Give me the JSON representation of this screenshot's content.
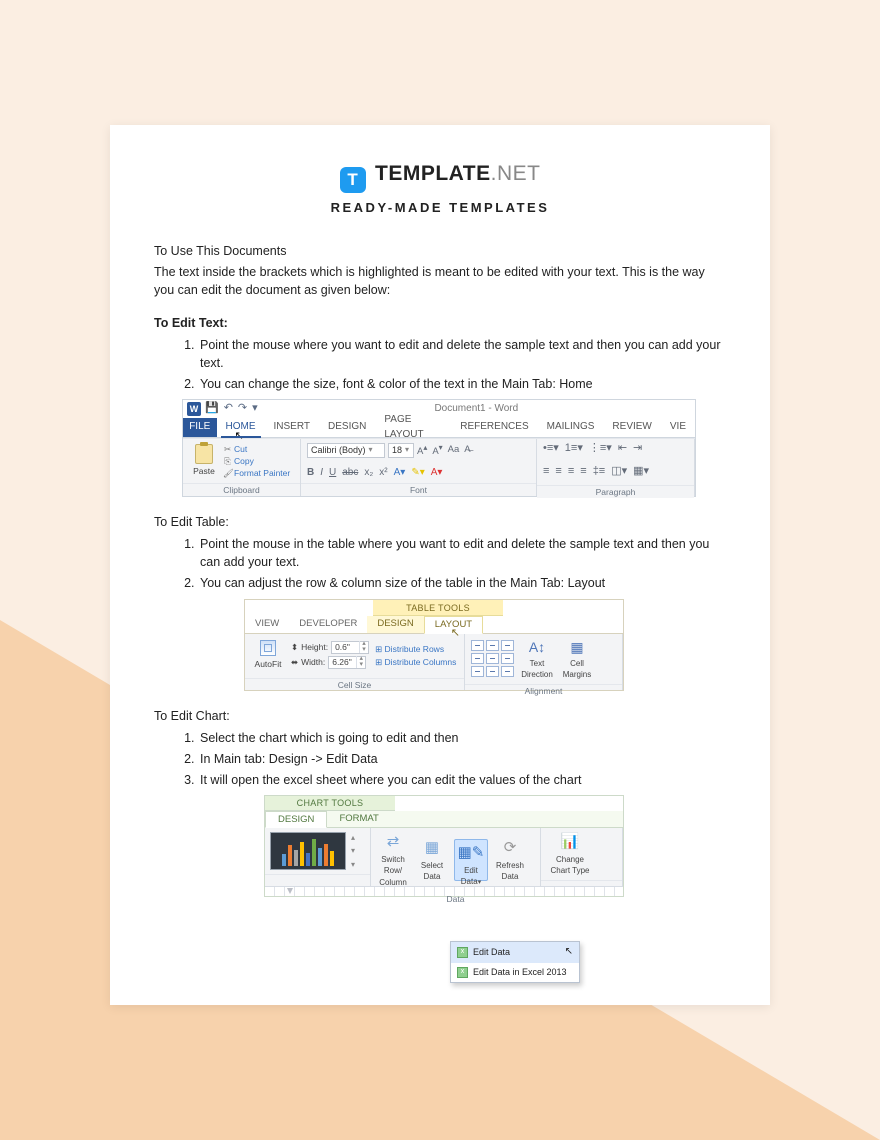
{
  "brand": {
    "badge": "T",
    "name": "TEMPLATE",
    "suffix": ".NET"
  },
  "subtitle": "READY-MADE TEMPLATES",
  "intro": {
    "heading": "To Use This Documents",
    "body": "The text inside the brackets which is highlighted is meant to be edited with your text. This is the way you can edit the document as given below:"
  },
  "sections": {
    "text": {
      "heading": "To Edit Text:",
      "steps": [
        "Point the mouse where you want to edit and delete the sample text and then you can add your text.",
        "You can change the size, font & color of the text in the Main Tab: Home"
      ]
    },
    "table": {
      "heading": "To Edit Table:",
      "steps": [
        "Point the mouse in the table where you want to edit and delete the sample text and then you can add your text.",
        "You can adjust the row & column size of the table in the Main Tab: Layout"
      ]
    },
    "chart": {
      "heading": "To Edit Chart:",
      "steps": [
        "Select the chart which is going to edit and then",
        "In Main tab: Design -> Edit Data",
        "It will open the excel sheet where you can edit the values of the chart"
      ]
    }
  },
  "word_ribbon": {
    "doc_title": "Document1 - Word",
    "file": "FILE",
    "tabs": [
      "HOME",
      "INSERT",
      "DESIGN",
      "PAGE LAYOUT",
      "REFERENCES",
      "MAILINGS",
      "REVIEW",
      "VIE"
    ],
    "clipboard": {
      "paste": "Paste",
      "cut": "Cut",
      "copy": "Copy",
      "format_painter": "Format Painter",
      "group": "Clipboard"
    },
    "font": {
      "family": "Calibri (Body)",
      "size": "18",
      "aa": "Aa",
      "group": "Font",
      "b": "B",
      "i": "I",
      "u": "U",
      "abc": "abc"
    },
    "paragraph": {
      "group": "Paragraph"
    }
  },
  "table_ribbon": {
    "tools_title": "TABLE TOOLS",
    "tabs_left": [
      "VIEW",
      "DEVELOPER"
    ],
    "tabs_tool": [
      "DESIGN",
      "LAYOUT"
    ],
    "autofit": "AutoFit",
    "height_label": "Height:",
    "height_val": "0.6\"",
    "width_label": "Width:",
    "width_val": "6.26\"",
    "dist_rows": "Distribute Rows",
    "dist_cols": "Distribute Columns",
    "cell_size": "Cell Size",
    "alignment": "Alignment",
    "text_dir": "Text Direction",
    "cell_margins": "Cell Margins"
  },
  "chart_ribbon": {
    "tools_title": "CHART TOOLS",
    "tabs": [
      "DESIGN",
      "FORMAT"
    ],
    "switch": "Switch Row/ Column",
    "select": "Select Data",
    "edit": "Edit Data",
    "refresh": "Refresh Data",
    "change": "Change Chart Type",
    "data_group": "Data",
    "menu1": "Edit Data",
    "menu2": "Edit Data in Excel 2013"
  }
}
